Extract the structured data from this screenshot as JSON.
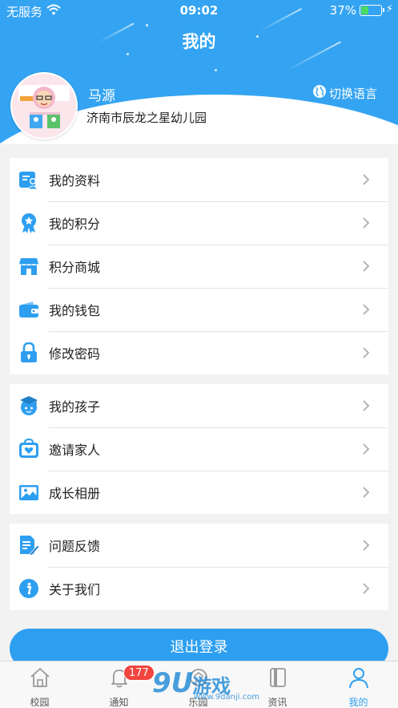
{
  "status_bar": {
    "carrier": "无服务",
    "time": "09:02",
    "battery_percent": "37%",
    "battery_level": 0.37,
    "charging_icon": "lightning-icon",
    "wifi_icon": "wifi-icon"
  },
  "header": {
    "title": "我的",
    "background_color": "#34a4f2"
  },
  "profile": {
    "name": "马源",
    "school": "济南市辰龙之星幼儿园",
    "avatar_icon": "avatar-image",
    "language_switch_label": "切换语言",
    "language_icon": "globe-icon"
  },
  "menu_groups": [
    {
      "items": [
        {
          "label": "我的资料",
          "icon": "profile-card-icon"
        },
        {
          "label": "我的积分",
          "icon": "medal-icon"
        },
        {
          "label": "积分商城",
          "icon": "store-icon"
        },
        {
          "label": "我的钱包",
          "icon": "wallet-icon"
        },
        {
          "label": "修改密码",
          "icon": "lock-icon"
        }
      ]
    },
    {
      "items": [
        {
          "label": "我的孩子",
          "icon": "graduate-child-icon"
        },
        {
          "label": "邀请家人",
          "icon": "heart-box-icon"
        },
        {
          "label": "成长相册",
          "icon": "photo-album-icon"
        }
      ]
    },
    {
      "items": [
        {
          "label": "问题反馈",
          "icon": "feedback-edit-icon"
        },
        {
          "label": "关于我们",
          "icon": "info-icon"
        }
      ]
    }
  ],
  "logout_label": "退出登录",
  "tabbar": {
    "tabs": [
      {
        "label": "校园",
        "icon": "home-icon"
      },
      {
        "label": "通知",
        "icon": "bell-icon",
        "badge": "177"
      },
      {
        "label": "乐园",
        "icon": "paradise-icon"
      },
      {
        "label": "资讯",
        "icon": "news-book-icon"
      },
      {
        "label": "我的",
        "icon": "person-icon",
        "active": true
      }
    ]
  },
  "watermark": {
    "big": "9U",
    "text": "游戏",
    "url": "www.9danji.com"
  },
  "accent_color": "#2e9ff0",
  "badge_color": "#f1453d"
}
